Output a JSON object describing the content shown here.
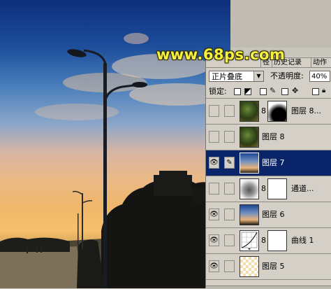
{
  "watermark": "www.68ps.com",
  "panel": {
    "tabs": [
      "径",
      "历史记录",
      "动作"
    ],
    "blend_mode": "正片叠底",
    "blend_arrow": "▼",
    "opacity_label": "不透明度:",
    "opacity_value": "40%",
    "lock_label": "锁定:",
    "layers": [
      {
        "name": "图层 8...",
        "visible": false,
        "has_mask": true,
        "thumb": "th-foliage",
        "mask_thumb": "th-dark"
      },
      {
        "name": "图层 8",
        "visible": false,
        "has_mask": false,
        "thumb": "th-foliage"
      },
      {
        "name": "图层 7",
        "visible": true,
        "selected": true,
        "brush": true,
        "has_mask": false,
        "thumb": "th-sky"
      },
      {
        "name": "通道...",
        "visible": false,
        "has_mask": true,
        "thumb": "th-grey",
        "mask_thumb": "blank"
      },
      {
        "name": "图层 6",
        "visible": true,
        "has_mask": false,
        "thumb": "th-sky"
      },
      {
        "name": "曲线 1",
        "visible": true,
        "has_mask": true,
        "thumb": "th-curve",
        "mask_thumb": "blank"
      },
      {
        "name": "图层 5",
        "visible": true,
        "has_mask": false,
        "thumb": "th-checker"
      }
    ]
  },
  "icons": {
    "eye": "eye-icon",
    "brush": "brush-icon",
    "chain": "link-icon",
    "lock": "lock-icon",
    "move": "move-icon"
  },
  "colors": {
    "selected_row": "#0a246a",
    "panel_bg": "#d4d0c8",
    "watermark": "#f6f040"
  }
}
